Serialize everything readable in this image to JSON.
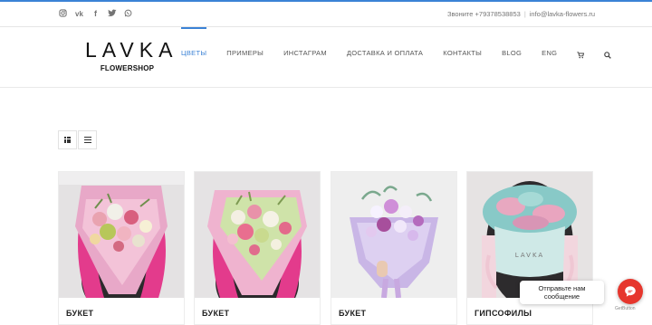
{
  "topbar": {
    "social": [
      {
        "icon": "instagram-icon",
        "glyph": "◎"
      },
      {
        "icon": "vk-icon",
        "glyph": "vk"
      },
      {
        "icon": "facebook-icon",
        "glyph": "f"
      },
      {
        "icon": "twitter-icon",
        "glyph": "🐦"
      },
      {
        "icon": "whatsapp-icon",
        "glyph": "✆"
      }
    ],
    "phone_text": "Звоните +79378538853",
    "email_text": "info@lavka-flowers.ru"
  },
  "header": {
    "logo_word": "LAVKA",
    "logo_sub": "FLOWERSHOP",
    "nav": [
      "ЦВЕТЫ",
      "ПРИМЕРЫ",
      "ИНСТАГРАМ",
      "ДОСТАВКА И ОПЛАТА",
      "КОНТАКТЫ",
      "BLOG",
      "ENG"
    ],
    "active_index": 0
  },
  "colors": {
    "accent": "#3b82d6",
    "chat_button": "#e6362d"
  },
  "products": [
    {
      "title": "БУКЕТ"
    },
    {
      "title": "БУКЕТ"
    },
    {
      "title": "БУКЕТ"
    },
    {
      "title": "ГИПСОФИЛЫ"
    }
  ],
  "chat": {
    "line1": "Отправьте нам",
    "line2": "сообщение",
    "brand": "GetButton"
  }
}
